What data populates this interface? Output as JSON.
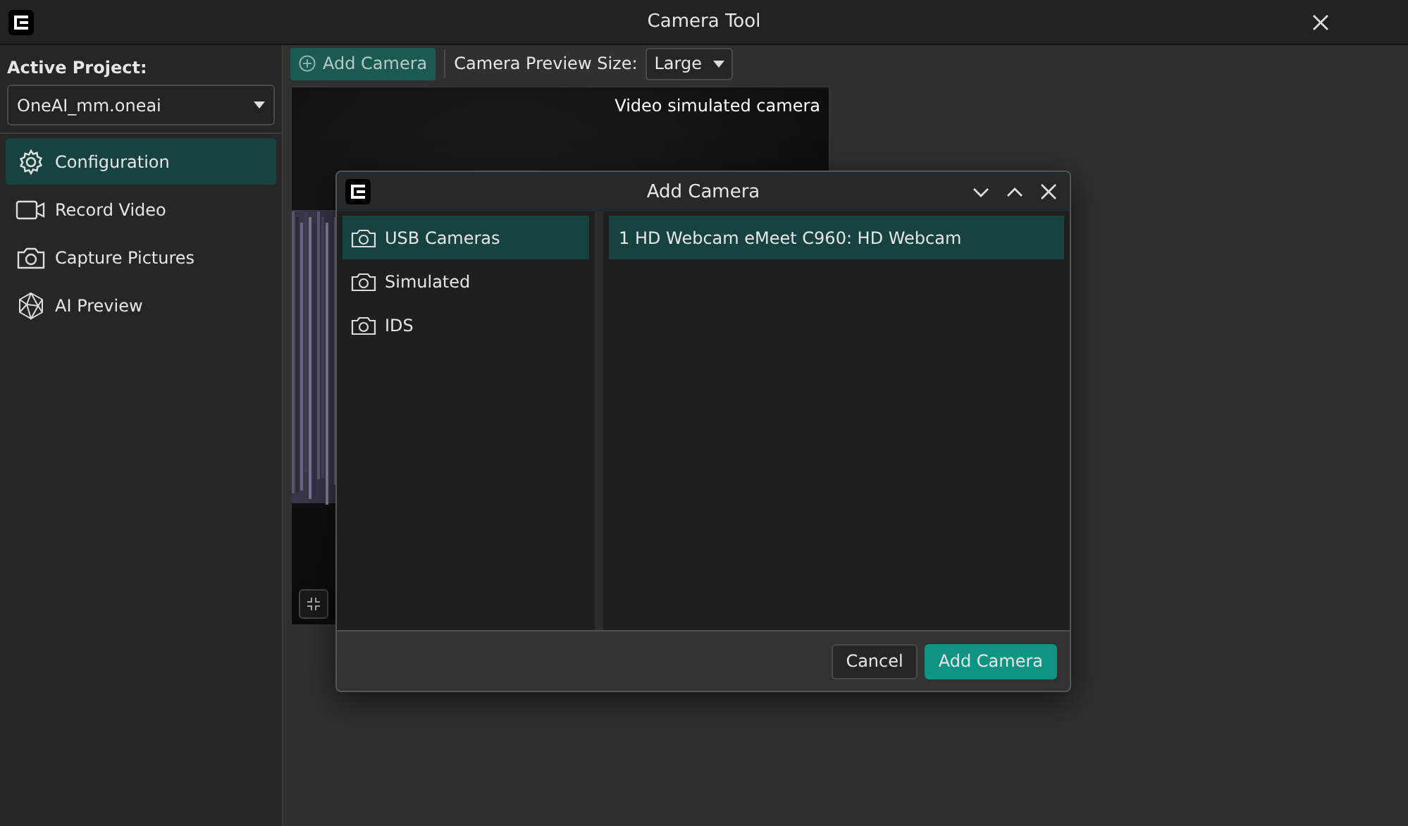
{
  "window": {
    "title": "Camera Tool"
  },
  "sidebar": {
    "project_label": "Active Project:",
    "project": "OneAI_mm.oneai",
    "items": [
      {
        "label": "Configuration",
        "kind": "gear",
        "selected": true
      },
      {
        "label": "Record Video",
        "kind": "video",
        "selected": false
      },
      {
        "label": "Capture Pictures",
        "kind": "camera",
        "selected": false
      },
      {
        "label": "AI Preview",
        "kind": "polyhedron",
        "selected": false
      }
    ]
  },
  "toolbar": {
    "add_button": "Add Camera",
    "size_label": "Camera Preview Size:",
    "size_value": "Large"
  },
  "preview": {
    "caption": "Video simulated camera"
  },
  "dialog": {
    "title": "Add Camera",
    "categories": [
      {
        "label": "USB Cameras",
        "selected": true
      },
      {
        "label": "Simulated",
        "selected": false
      },
      {
        "label": "IDS",
        "selected": false
      }
    ],
    "devices": [
      {
        "label": "1 HD Webcam eMeet C960: HD Webcam",
        "selected": true
      }
    ],
    "buttons": [
      {
        "label": "Cancel",
        "kind": "secondary"
      },
      {
        "label": "Add Camera",
        "kind": "primary"
      }
    ]
  }
}
